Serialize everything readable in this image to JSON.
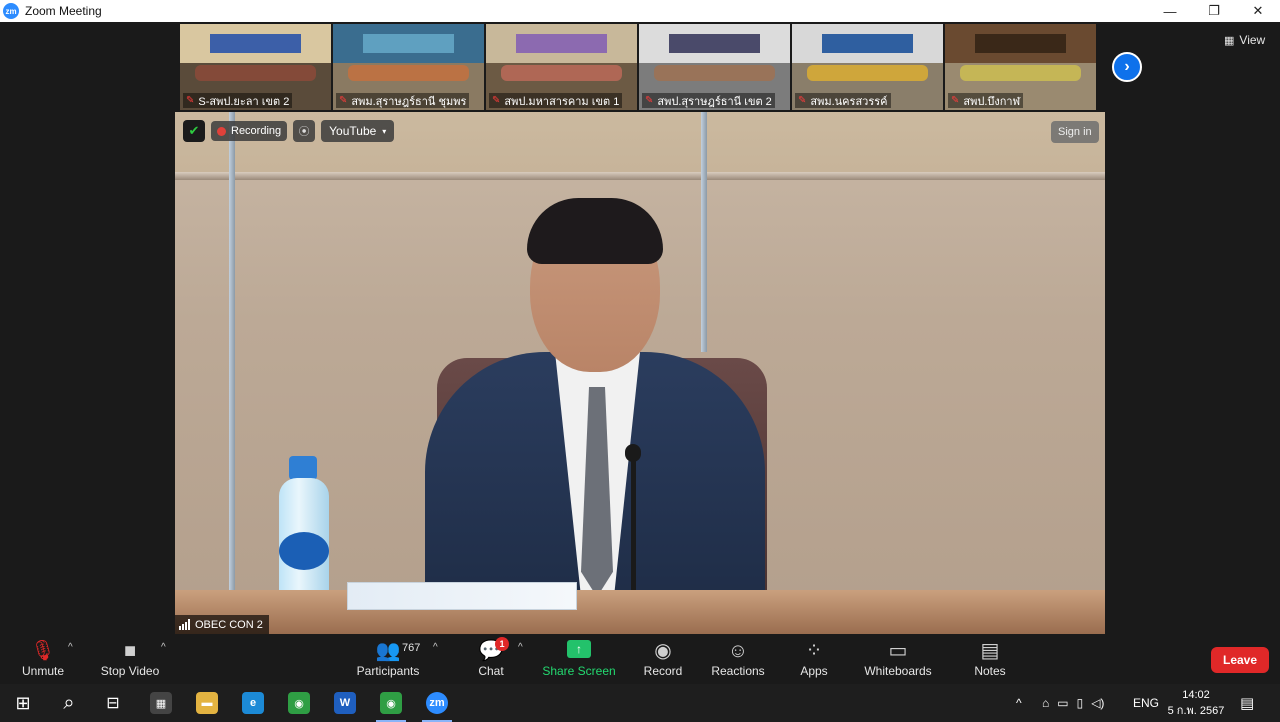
{
  "window": {
    "title": "Zoom Meeting",
    "minimize": "—",
    "restore": "❐",
    "close": "✕"
  },
  "thumbnails": [
    {
      "name": "S-สพป.ยะลา เขต 2",
      "top": "#d9c7a0",
      "bottom": "#5a4b3a",
      "banner": "#3c5fa8",
      "people": "#8f4a3a"
    },
    {
      "name": "สพม.สุราษฎร์ธานี ชุมพร",
      "top": "#3a6d8f",
      "bottom": "#8a7a62",
      "banner": "#5fa0c0",
      "people": "#c7703d"
    },
    {
      "name": "สพป.มหาสารคาม เขต 1",
      "top": "#c8b89a",
      "bottom": "#6c5a44",
      "banner": "#8c6ab0",
      "people": "#c06a5a"
    },
    {
      "name": "สพป.สุราษฎร์ธานี เขต 2",
      "top": "#dcdcdc",
      "bottom": "#7c7c7c",
      "banner": "#4a4a6a",
      "people": "#a07050"
    },
    {
      "name": "สพม.นครสวรรค์",
      "top": "#d8d8d8",
      "bottom": "#8a7e6a",
      "banner": "#2f5fa0",
      "people": "#e0b030"
    },
    {
      "name": "สพป.บึงกาฬ",
      "top": "#6a4a30",
      "bottom": "#9a8a70",
      "banner": "#3a2818",
      "people": "#d0c050"
    }
  ],
  "thumbs_next_icon": "›",
  "view_label": "View",
  "view_icon": "▦",
  "video_overlay": {
    "shield_icon": "✔",
    "recording_label": "Recording",
    "rss_icon": "⦿",
    "youtube_label": "YouTube",
    "youtube_caret": "▾",
    "sign_in_label": "Sign in",
    "speaker_name": "OBEC CON 2"
  },
  "toolbar": {
    "unmute": {
      "label": "Unmute",
      "icon": "🎙"
    },
    "stop_video": {
      "label": "Stop Video",
      "icon": "■"
    },
    "participants": {
      "label": "Participants",
      "icon": "👥",
      "count": "767"
    },
    "chat": {
      "label": "Chat",
      "icon": "💬",
      "badge": "1"
    },
    "share_screen": {
      "label": "Share Screen",
      "icon": "↑"
    },
    "record": {
      "label": "Record",
      "icon": "◉"
    },
    "reactions": {
      "label": "Reactions",
      "icon": "☺"
    },
    "apps": {
      "label": "Apps",
      "icon": "⁘"
    },
    "whiteboards": {
      "label": "Whiteboards",
      "icon": "▭"
    },
    "notes": {
      "label": "Notes",
      "icon": "▤"
    },
    "caret": "^",
    "leave_label": "Leave"
  },
  "taskbar": {
    "start_icon": "⊞",
    "search_icon": "⌕",
    "taskview_icon": "⊟",
    "apps": [
      {
        "name": "qr",
        "glyph": "▦",
        "color": "#444444"
      },
      {
        "name": "explorer",
        "glyph": "▬",
        "color": "#e3b341"
      },
      {
        "name": "edge",
        "glyph": "e",
        "color": "#1c8ad6"
      },
      {
        "name": "chrome",
        "glyph": "◉",
        "color": "#2f9e44"
      },
      {
        "name": "webex",
        "glyph": "W",
        "color": "#1f5fbf"
      },
      {
        "name": "chrome2",
        "glyph": "◉",
        "color": "#2f9e44"
      },
      {
        "name": "zoom",
        "glyph": "zm",
        "color": "#2d8cff"
      }
    ],
    "tray_caret": "^",
    "lang": "ENG",
    "time": "14:02",
    "date": "5 ก.พ. 2567",
    "notif_icon": "▤"
  },
  "colors": {
    "accent": "#2d8cff",
    "leave": "#e02828",
    "share": "#23c26b"
  }
}
